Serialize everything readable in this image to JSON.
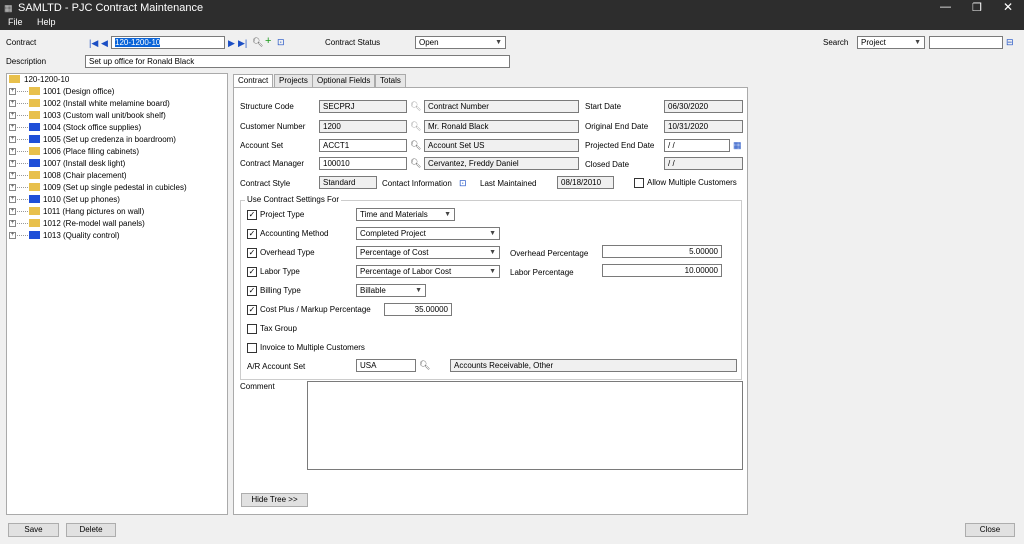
{
  "window": {
    "app": "SAMLTD",
    "separator": "-",
    "title": "PJC Contract Maintenance"
  },
  "menu": [
    "File",
    "Help"
  ],
  "header": {
    "contract_label": "Contract",
    "contract_value": "120-1200-10",
    "status_label": "Contract Status",
    "status_value": "Open",
    "search_label": "Search",
    "search_value": "Project",
    "search_input": "",
    "description_label": "Description",
    "description_value": "Set up office for Ronald Black"
  },
  "tree": {
    "root": "120-1200-10",
    "items": [
      {
        "label": "1001 (Design office)",
        "color": "yellow"
      },
      {
        "label": "1002 (Install white melamine board)",
        "color": "yellow"
      },
      {
        "label": "1003 (Custom wall unit/book shelf)",
        "color": "yellow"
      },
      {
        "label": "1004 (Stock office supplies)",
        "color": "blue"
      },
      {
        "label": "1005 (Set up credenza in boardroom)",
        "color": "blue"
      },
      {
        "label": "1006 (Place filing cabinets)",
        "color": "yellow"
      },
      {
        "label": "1007 (Install desk light)",
        "color": "blue"
      },
      {
        "label": "1008 (Chair placement)",
        "color": "yellow"
      },
      {
        "label": "1009 (Set up single pedestal in cubicles)",
        "color": "yellow"
      },
      {
        "label": "1010 (Set up phones)",
        "color": "blue"
      },
      {
        "label": "1011 (Hang pictures on wall)",
        "color": "yellow"
      },
      {
        "label": "1012 (Re-model wall panels)",
        "color": "yellow"
      },
      {
        "label": "1013 (Quality control)",
        "color": "blue"
      }
    ]
  },
  "tabs": [
    "Contract",
    "Projects",
    "Optional Fields",
    "Totals"
  ],
  "contract": {
    "structure_code_label": "Structure Code",
    "structure_code": "SECPRJ",
    "structure_desc": "Contract Number",
    "customer_number_label": "Customer Number",
    "customer_number": "1200",
    "customer_name": "Mr. Ronald Black",
    "account_set_label": "Account Set",
    "account_set": "ACCT1",
    "account_set_desc": "Account Set US",
    "contract_manager_label": "Contract Manager",
    "contract_manager": "100010",
    "manager_name": "Cervantez, Freddy Daniel",
    "contract_style_label": "Contract Style",
    "contract_style": "Standard",
    "contact_info_label": "Contact Information",
    "last_maintained_label": "Last Maintained",
    "last_maintained": "08/18/2010",
    "allow_multiple_label": "Allow Multiple Customers",
    "start_date_label": "Start Date",
    "start_date": "06/30/2020",
    "original_end_label": "Original End Date",
    "original_end": "10/31/2020",
    "projected_end_label": "Projected End Date",
    "projected_end": "/ /",
    "closed_date_label": "Closed Date",
    "closed_date": "/ /"
  },
  "settings": {
    "group_label": "Use Contract Settings For",
    "project_type_label": "Project Type",
    "project_type": "Time and Materials",
    "accounting_method_label": "Accounting Method",
    "accounting_method": "Completed Project",
    "overhead_type_label": "Overhead Type",
    "overhead_type": "Percentage of Cost",
    "overhead_pct_label": "Overhead Percentage",
    "overhead_pct": "5.00000",
    "labor_type_label": "Labor Type",
    "labor_type": "Percentage of Labor Cost",
    "labor_pct_label": "Labor Percentage",
    "labor_pct": "10.00000",
    "billing_type_label": "Billing Type",
    "billing_type": "Billable",
    "cost_plus_label": "Cost Plus / Markup Percentage",
    "cost_plus": "35.00000",
    "tax_group_label": "Tax Group",
    "invoice_multiple_label": "Invoice to Multiple Customers",
    "ar_account_set_label": "A/R Account Set",
    "ar_account_set": "USA",
    "ar_account_desc": "Accounts Receivable, Other"
  },
  "comment_label": "Comment",
  "buttons": {
    "hide_tree": "Hide Tree >>",
    "save": "Save",
    "delete": "Delete",
    "close": "Close"
  }
}
